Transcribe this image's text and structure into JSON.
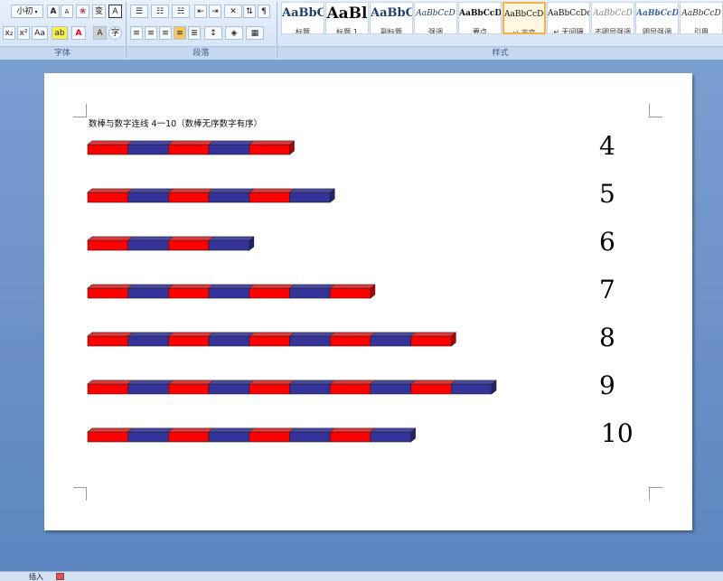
{
  "ribbon": {
    "font": {
      "size_value": "小初",
      "group_label": "字体",
      "grow_label": "A",
      "shrink_label": "A",
      "clear_label": "❀",
      "phonetic_label": "变",
      "border_label": "A",
      "subscript_label": "x₂",
      "superscript_label": "x²",
      "case_label": "Aa",
      "highlight_label": "ab",
      "font_color_label": "A",
      "char_shade_label": "A",
      "enclose_label": "字"
    },
    "paragraph": {
      "group_label": "段落"
    },
    "styles": {
      "group_label": "样式",
      "items": [
        {
          "sample": "AaBbC",
          "name": "标题"
        },
        {
          "sample": "AaBl",
          "name": "标题 1"
        },
        {
          "sample": "AaBbC",
          "name": "副标题"
        },
        {
          "sample": "AaBbCcD",
          "name": "强调"
        },
        {
          "sample": "AaBbCcD",
          "name": "要点"
        },
        {
          "sample": "AaBbCcDc",
          "name": "↵ 正文"
        },
        {
          "sample": "AaBbCcDc",
          "name": "↵ 无间隔"
        },
        {
          "sample": "AaBbCcD",
          "name": "不明显强调"
        },
        {
          "sample": "AaBbCcD",
          "name": "明显强调"
        },
        {
          "sample": "AaBbCcD",
          "name": "引用"
        }
      ]
    }
  },
  "document": {
    "title": "数棒与数字连线 4一10（数棒无序数字有序）",
    "numbers": [
      "4",
      "5",
      "6",
      "7",
      "8",
      "9",
      "10"
    ],
    "bar_lengths": [
      5,
      6,
      4,
      7,
      9,
      10,
      8
    ],
    "colors": {
      "red": "#ff0000",
      "blue": "#333399"
    }
  },
  "statusbar": {
    "mode_label": "插入"
  }
}
